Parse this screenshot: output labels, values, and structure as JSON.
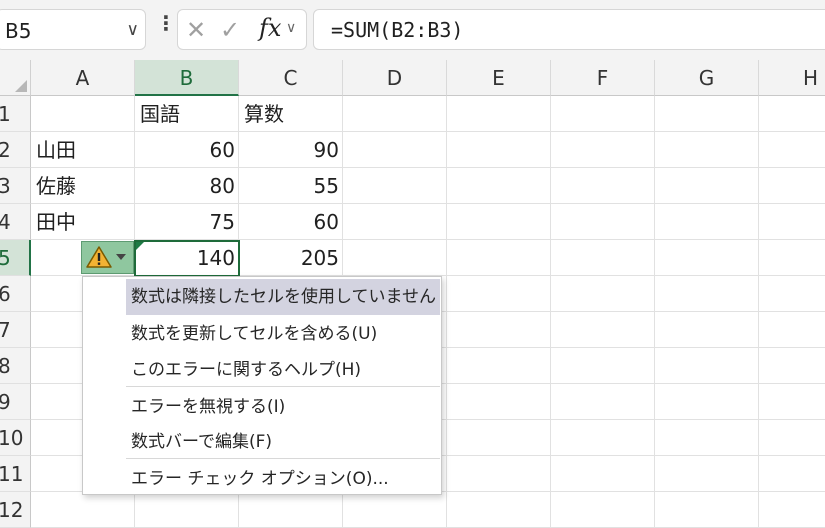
{
  "namebox": {
    "value": "B5"
  },
  "formula_bar": {
    "value": "=SUM(B2:B3)",
    "fx_label": "fx"
  },
  "columns": [
    "A",
    "B",
    "C",
    "D",
    "E",
    "F",
    "G",
    "H"
  ],
  "rows": [
    "1",
    "2",
    "3",
    "4",
    "5",
    "6",
    "7",
    "8",
    "9",
    "10",
    "11",
    "12"
  ],
  "cells": {
    "B1": "国語",
    "C1": "算数",
    "A2": "山田",
    "B2": "60",
    "C2": "90",
    "A3": "佐藤",
    "B3": "80",
    "C3": "55",
    "A4": "田中",
    "B4": "75",
    "C4": "60",
    "B5": "140",
    "C5": "205"
  },
  "selection": {
    "active_cell": "B5",
    "column": "B",
    "row": "5"
  },
  "error_menu": {
    "items": [
      {
        "label": "数式は隣接したセルを使用していません",
        "highlighted": true
      },
      {
        "label": "数式を更新してセルを含める(U)"
      },
      {
        "label": "このエラーに関するヘルプ(H)"
      },
      {
        "label": "エラーを無視する(I)"
      },
      {
        "label": "数式バーで編集(F)"
      },
      {
        "label": "エラー チェック オプション(O)..."
      }
    ]
  },
  "colors": {
    "accent": "#217346",
    "error_button": "#8fc79f",
    "warning": "#f2b233",
    "menu_highlight": "#d3d3e0"
  },
  "icons": {
    "error_indicator": "warning-triangle-icon",
    "cancel": "x-icon",
    "enter": "checkmark-icon"
  }
}
